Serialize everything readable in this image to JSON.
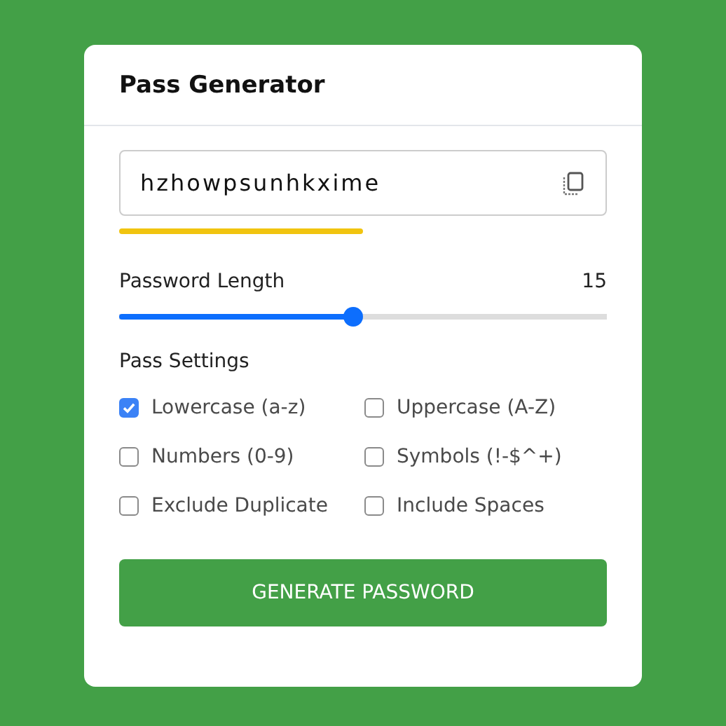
{
  "title": "Pass Generator",
  "password": {
    "value": "hzhowpsunhkxime"
  },
  "length": {
    "label": "Password Length",
    "reading": "15",
    "level": 0.48
  },
  "settings": {
    "heading": "Pass Settings",
    "options": [
      {
        "label": "Lowercase (a-z)",
        "checked": true
      },
      {
        "label": "Uppercase (A-Z)",
        "checked": false
      },
      {
        "label": "Numbers (0-9)",
        "checked": false
      },
      {
        "label": "Symbols (!-$^+)",
        "checked": false
      },
      {
        "label": "Exclude Duplicate",
        "checked": false
      },
      {
        "label": "Include Spaces",
        "checked": false
      }
    ]
  },
  "button": "GENERATE PASSWORD"
}
